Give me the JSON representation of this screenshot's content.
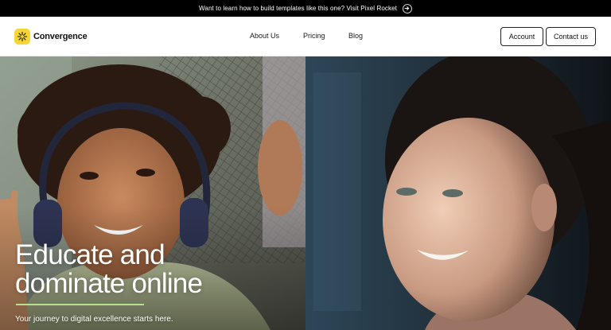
{
  "announcement": {
    "text": "Want to learn how to build templates like this one? Visit Pixel Rocket",
    "icon": "arrow-right-icon"
  },
  "brand": {
    "name": "Convergence",
    "logo_icon": "sunburst-logo-icon",
    "logo_color": "#f6d636"
  },
  "nav": {
    "links": [
      "About Us",
      "Pricing",
      "Blog"
    ],
    "account_label": "Account",
    "contact_label": "Contact us"
  },
  "hero": {
    "title_line1": "Educate and",
    "title_line2": "dominate online",
    "subtitle": "Your journey to digital excellence starts here.",
    "accent_color": "#b7e08a"
  }
}
